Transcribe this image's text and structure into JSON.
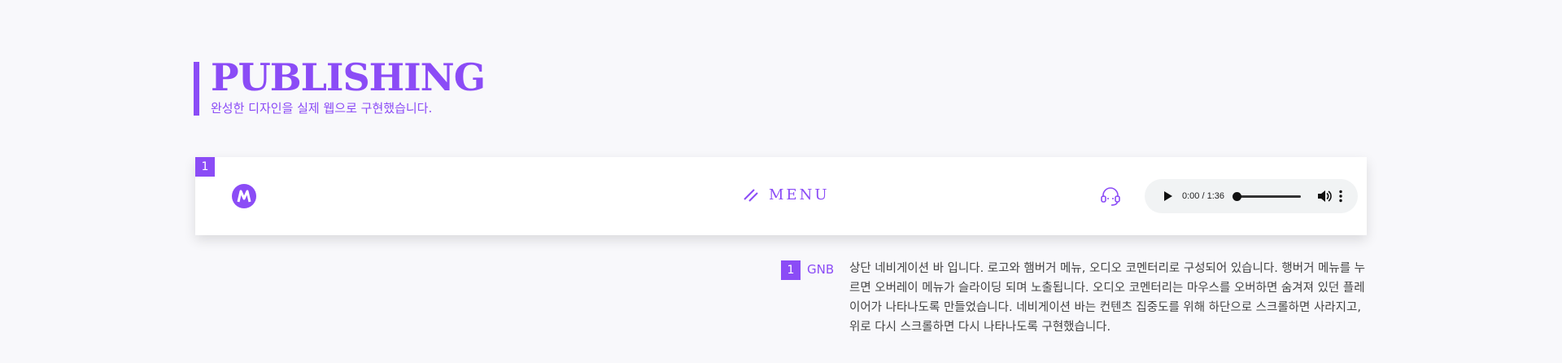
{
  "header": {
    "title": "PUBLISHING",
    "subtitle": "완성한 디자인을 실제 웹으로 구현했습니다."
  },
  "nav_preview": {
    "badge": "1",
    "menu_label": "MENU",
    "audio": {
      "time": "0:00 / 1:36",
      "progress": 0
    }
  },
  "description": {
    "badge": "1",
    "label": "GNB",
    "text": "상단 네비게이션 바 입니다. 로고와 햄버거 메뉴, 오디오 코멘터리로 구성되어 있습니다. 행버거 메뉴를 누르면 오버레이 메뉴가 슬라이딩 되며 노출됩니다. 오디오 코멘터리는 마우스를 오버하면 숨겨져 있던 플레이어가 나타나도록 만들었습니다. 네비게이션 바는 컨텐츠 집중도를 위해 하단으로 스크롤하면 사라지고, 위로 다시 스크롤하면 다시 나타나도록 구현했습니다."
  },
  "colors": {
    "accent": "#8b4cf6",
    "background": "#f8f8fb"
  },
  "icons": [
    "logo-icon",
    "hamburger-slash-icon",
    "headset-icon",
    "play-icon",
    "volume-icon",
    "more-vertical-icon"
  ]
}
